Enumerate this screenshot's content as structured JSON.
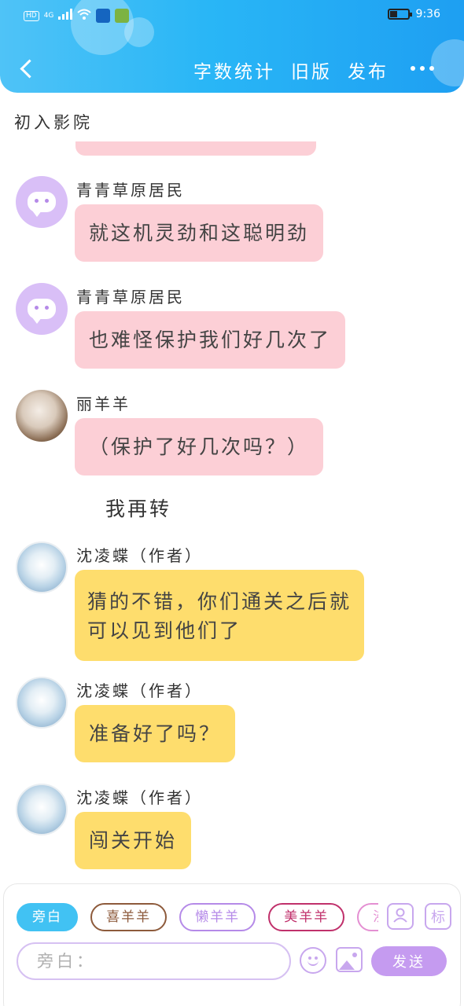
{
  "status_bar": {
    "network": "4G",
    "time": "9:36",
    "badge": "HD"
  },
  "header": {
    "actions": [
      "字数统计",
      "旧版",
      "发布"
    ],
    "colors": {
      "gradient_start": "#4fc3f7",
      "gradient_end": "#1e9ff2"
    }
  },
  "scene": {
    "title": "初入影院"
  },
  "messages": [
    {
      "name": "青青草原居民",
      "text": "就这机灵劲和这聪明劲",
      "avatar": "chat-bubble-icon",
      "style": "pink"
    },
    {
      "name": "青青草原居民",
      "text": "也难怪保护我们好几次了",
      "avatar": "chat-bubble-icon",
      "style": "pink"
    },
    {
      "name": "丽羊羊",
      "text": "（保护了好几次吗？）",
      "avatar": "photo",
      "style": "pink"
    },
    {
      "name": "沈凌蝶（作者）",
      "text_lines": [
        "猜的不错，你们通关之后就",
        "可以见到他们了"
      ],
      "avatar": "author-photo",
      "style": "yellow"
    },
    {
      "name": "沈凌蝶（作者）",
      "text": "准备好了吗？",
      "avatar": "author-photo",
      "style": "yellow"
    },
    {
      "name": "沈凌蝶（作者）",
      "text": "闯关开始",
      "avatar": "author-photo",
      "style": "yellow"
    }
  ],
  "narration": "我再转",
  "composer": {
    "roles": [
      {
        "label": "旁白",
        "color": "#41c2f3",
        "active": true
      },
      {
        "label": "喜羊羊",
        "color": "#8d5a3b"
      },
      {
        "label": "懒羊羊",
        "color": "#b58ae8"
      },
      {
        "label": "美羊羊",
        "color": "#c0306b"
      },
      {
        "label": "沸羊羊",
        "color": "#e48fd2"
      }
    ],
    "input_placeholder": "旁白：",
    "mark_label": "标",
    "send_label": "发送",
    "colors": {
      "accent": "#c59bf0",
      "pink_bubble": "#fccfd6",
      "yellow_bubble": "#fedd6d"
    }
  }
}
